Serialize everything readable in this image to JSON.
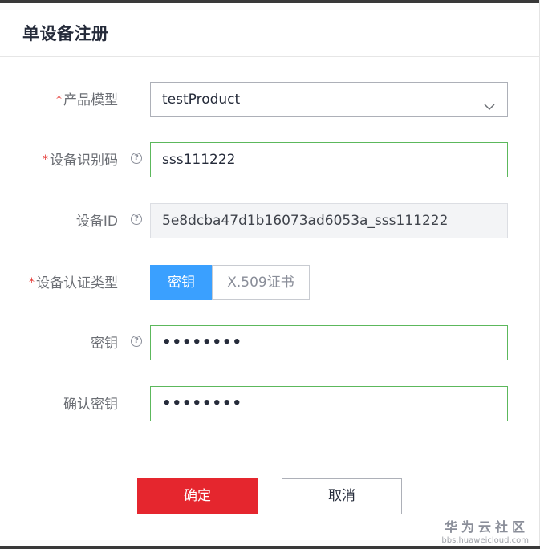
{
  "dialog": {
    "title": "单设备注册"
  },
  "form": {
    "product_model": {
      "label": "产品模型",
      "required_mark": "*",
      "value": "testProduct"
    },
    "device_identifier": {
      "label": "设备识别码",
      "required_mark": "*",
      "help": "?",
      "value": "sss111222"
    },
    "device_id": {
      "label": "设备ID",
      "help": "?",
      "value": "5e8dcba47d1b16073ad6053a_sss111222"
    },
    "auth_type": {
      "label": "设备认证类型",
      "required_mark": "*",
      "options": [
        "密钥",
        "X.509证书"
      ],
      "selected": "密钥"
    },
    "secret": {
      "label": "密钥",
      "help": "?",
      "value": "••••••••"
    },
    "confirm_secret": {
      "label": "确认密钥",
      "value": "••••••••"
    }
  },
  "buttons": {
    "confirm": "确定",
    "cancel": "取消"
  },
  "watermark": {
    "title": "华为云社区",
    "url": "bbs.huaweicloud.com"
  },
  "colors": {
    "primary_button": "#e5262e",
    "segment_active": "#3aa0ff",
    "valid_border": "#5cb85c",
    "required": "#e53935"
  },
  "icons": {
    "dropdown": "chevron-down-icon",
    "help": "help-circle-icon"
  }
}
